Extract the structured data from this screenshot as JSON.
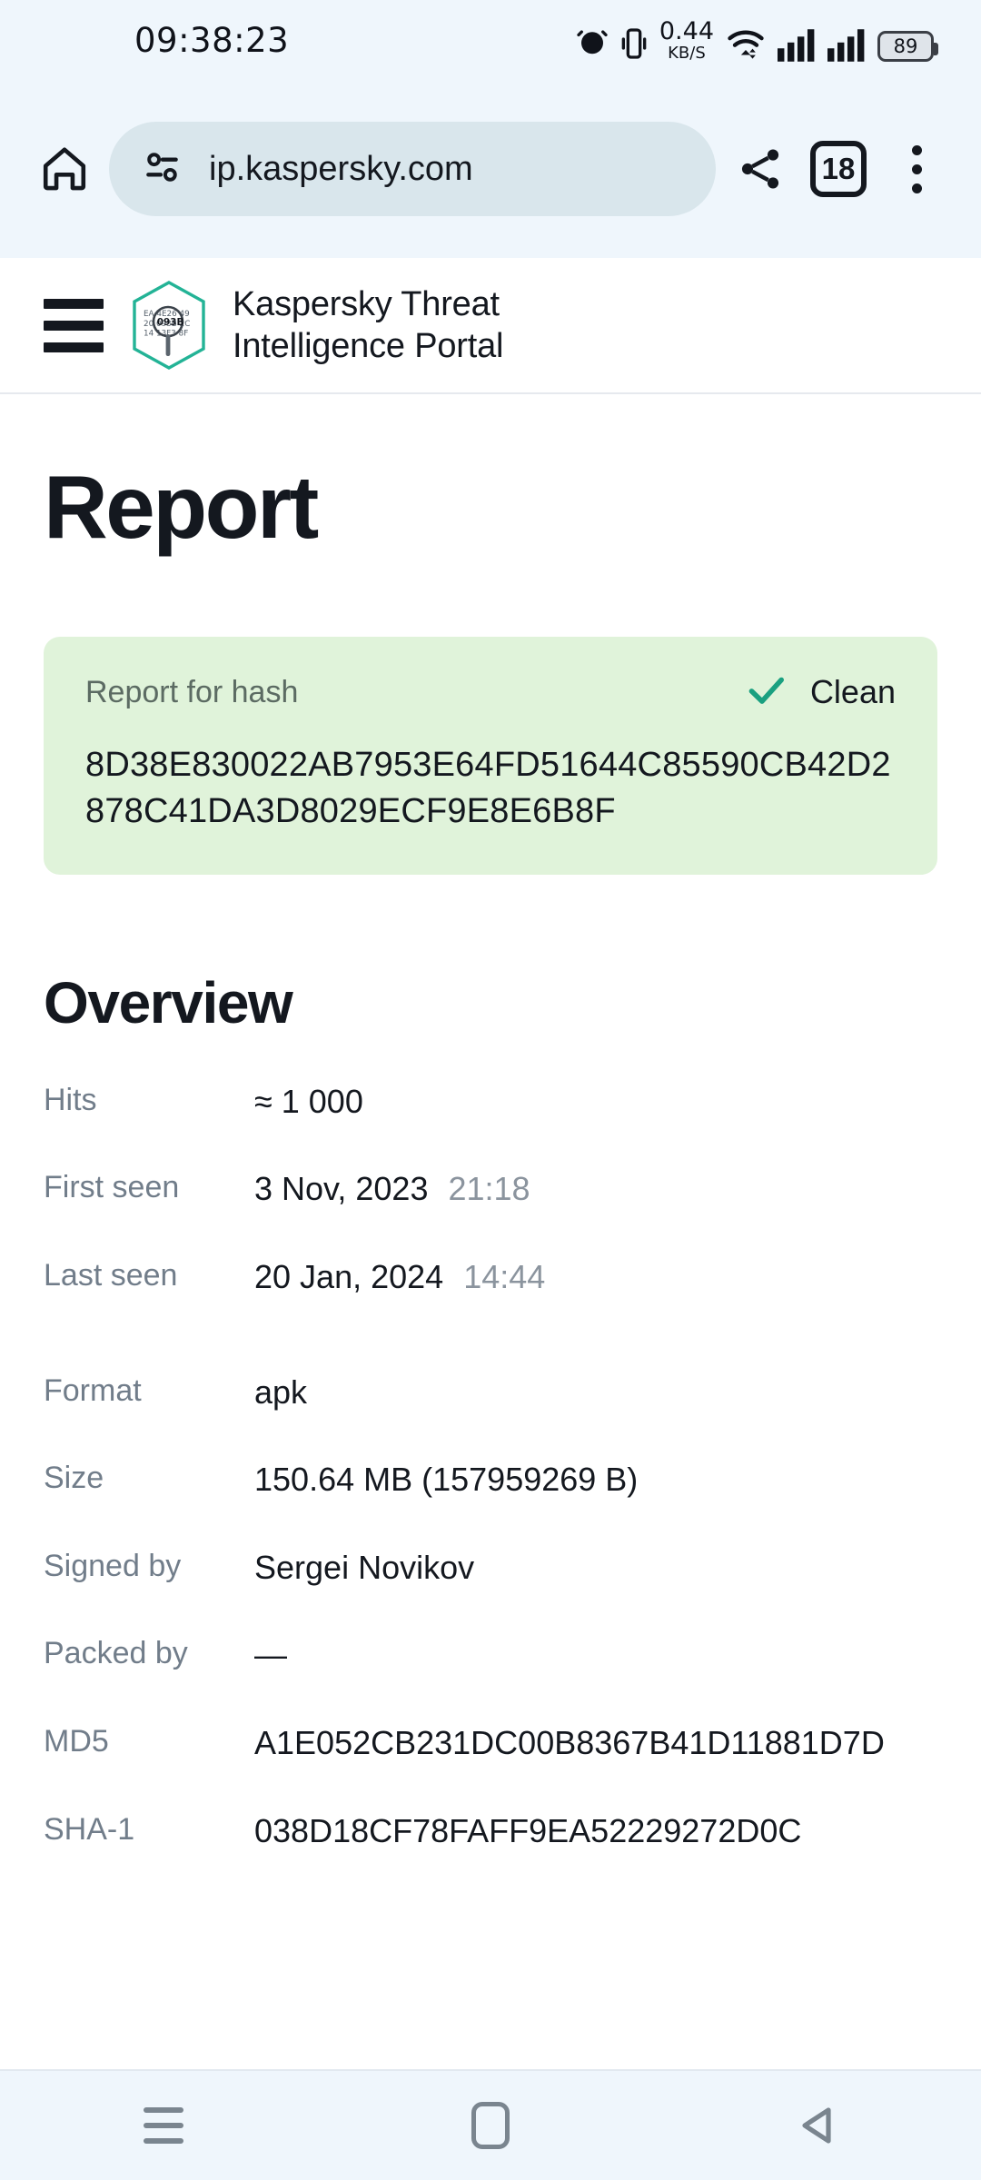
{
  "status_bar": {
    "clock": "09:38:23",
    "net_speed_value": "0.44",
    "net_speed_unit": "KB/S",
    "battery_level": "89",
    "icons": [
      "alarm-icon",
      "vibrate-icon",
      "wifi-icon",
      "signal-icon",
      "signal-icon",
      "battery-icon"
    ]
  },
  "browser": {
    "url": "ip.kaspersky.com",
    "tab_count": "18",
    "icons": [
      "home-icon",
      "site-settings-icon",
      "share-icon",
      "tab-switcher-icon",
      "overflow-menu-icon"
    ]
  },
  "site": {
    "title_line1": "Kaspersky Threat",
    "title_line2": "Intelligence Portal",
    "logo_codes": [
      "EA 4E26 49",
      "20 093B 2C",
      "14 13F3 8F"
    ],
    "logo_center": "093B"
  },
  "page": {
    "title": "Report",
    "verdict": {
      "label": "Report for hash",
      "status": "Clean",
      "status_color": "#1aa080",
      "card_color": "#e0f3da",
      "hash": "8D38E830022AB7953E64FD51644C85590CB42D2878C41DA3D8029ECF9E8E6B8F"
    },
    "overview_title": "Overview",
    "overview_primary": [
      {
        "key": "Hits",
        "value": "≈ 1 000",
        "sub": ""
      },
      {
        "key": "First seen",
        "value": "3 Nov, 2023",
        "sub": "21:18"
      },
      {
        "key": "Last seen",
        "value": "20 Jan, 2024",
        "sub": "14:44"
      }
    ],
    "overview_file": [
      {
        "key": "Format",
        "value": "apk",
        "sub": ""
      },
      {
        "key": "Size",
        "value": "150.64 MB (157959269 B)",
        "sub": ""
      },
      {
        "key": "Signed by",
        "value": "Sergei Novikov",
        "sub": ""
      },
      {
        "key": "Packed by",
        "value": "—",
        "sub": ""
      },
      {
        "key": "MD5",
        "value": "A1E052CB231DC00B8367B41D11881D7D",
        "sub": ""
      },
      {
        "key": "SHA-1",
        "value": "038D18CF78FAFF9EA52229272D0C",
        "sub": ""
      }
    ]
  },
  "nav_bar": {
    "recents_label": "recents-button",
    "home_label": "home-button",
    "back_label": "back-button"
  }
}
